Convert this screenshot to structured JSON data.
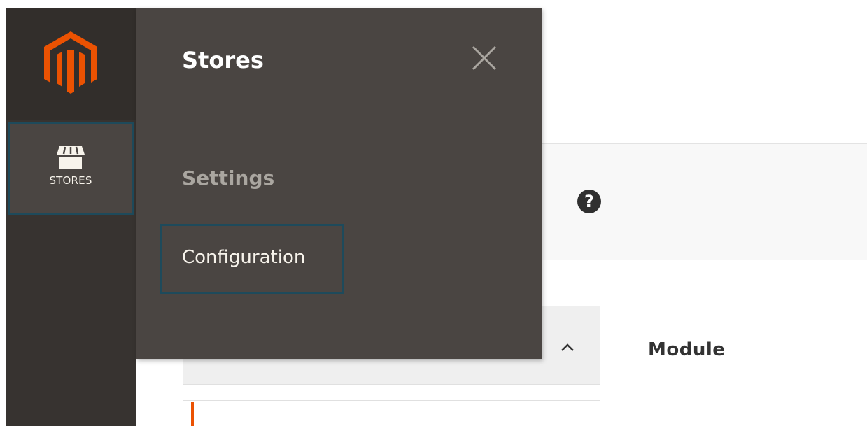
{
  "brand": {
    "logo_color": "#eb5202",
    "logo_icon": "magento-logo-icon"
  },
  "sidebar": {
    "background": "#373330",
    "active_item": {
      "label": "STORES",
      "icon": "storefront-icon"
    }
  },
  "flyout": {
    "title": "Stores",
    "close_icon": "close-icon",
    "sections": [
      {
        "heading": "Settings",
        "items": [
          {
            "label": "Configuration"
          }
        ]
      }
    ]
  },
  "page": {
    "help_icon": "question-circle-icon",
    "grid": {
      "sort_icon": "chevron-up-icon",
      "columns": [
        {
          "label": "Module"
        }
      ]
    }
  },
  "colors": {
    "highlight_border": "#1e4a5b",
    "accent": "#eb5202",
    "flyout_bg": "#4a4542"
  }
}
